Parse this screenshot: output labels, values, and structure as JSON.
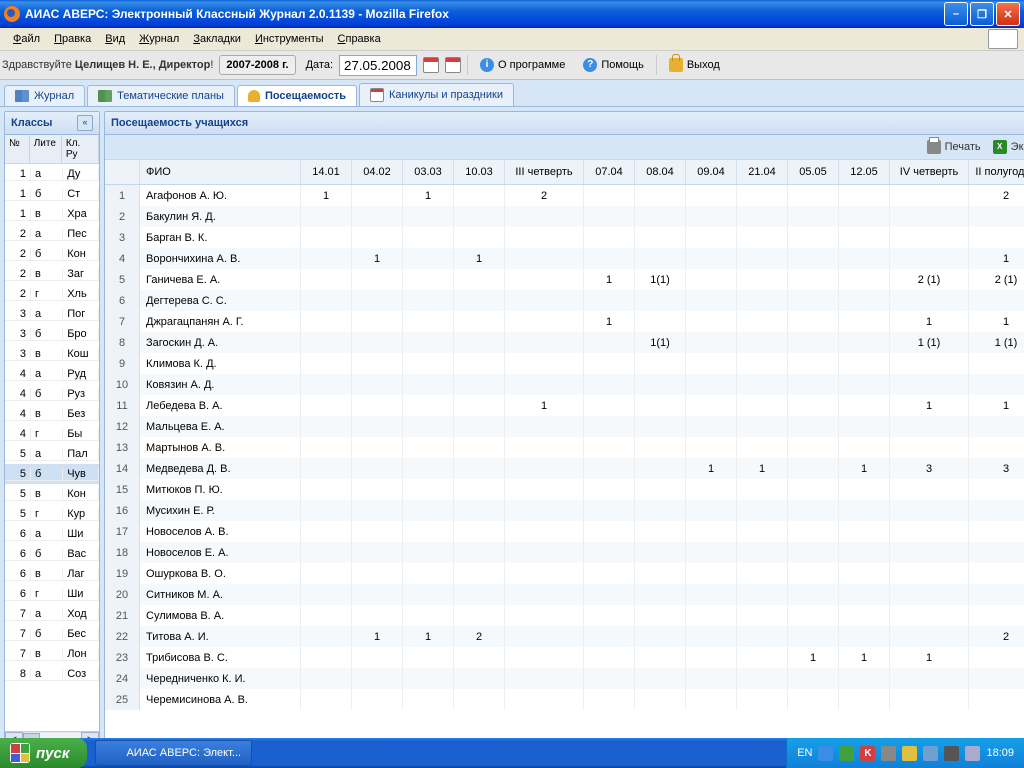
{
  "window": {
    "title": "АИАС АВЕРС: Электронный Классный Журнал 2.0.1139 - Mozilla Firefox"
  },
  "menu": {
    "file": "Файл",
    "edit": "Правка",
    "view": "Вид",
    "journal": "Журнал",
    "bookmarks": "Закладки",
    "tools": "Инструменты",
    "help": "Справка"
  },
  "greeting": {
    "prefix": "Здравствуйте ",
    "name": "Целищев Н. Е., Директор",
    "suffix": "!"
  },
  "year": "2007-2008 г.",
  "date_label": "Дата:",
  "date_value": "27.05.2008",
  "tb": {
    "about": "О программе",
    "help": "Помощь",
    "exit": "Выход"
  },
  "tabs": {
    "journal": "Журнал",
    "plans": "Тематические планы",
    "attendance": "Посещаемость",
    "holidays": "Каникулы и праздники"
  },
  "left": {
    "title": "Классы",
    "col_no": "№",
    "col_lit": "Лите",
    "col_ruk": "Кл. Ру",
    "rows": [
      {
        "n": "1",
        "l": "а",
        "r": "Ду"
      },
      {
        "n": "1",
        "l": "б",
        "r": "Ст"
      },
      {
        "n": "1",
        "l": "в",
        "r": "Хра"
      },
      {
        "n": "2",
        "l": "а",
        "r": "Пес"
      },
      {
        "n": "2",
        "l": "б",
        "r": "Кон"
      },
      {
        "n": "2",
        "l": "в",
        "r": "Заг"
      },
      {
        "n": "2",
        "l": "г",
        "r": "Хль"
      },
      {
        "n": "3",
        "l": "а",
        "r": "Пог"
      },
      {
        "n": "3",
        "l": "б",
        "r": "Бро"
      },
      {
        "n": "3",
        "l": "в",
        "r": "Кош"
      },
      {
        "n": "4",
        "l": "а",
        "r": "Руд"
      },
      {
        "n": "4",
        "l": "б",
        "r": "Руз"
      },
      {
        "n": "4",
        "l": "в",
        "r": "Без"
      },
      {
        "n": "4",
        "l": "г",
        "r": "Бы"
      },
      {
        "n": "5",
        "l": "а",
        "r": "Пал"
      },
      {
        "n": "5",
        "l": "б",
        "r": "Чув"
      },
      {
        "n": "5",
        "l": "в",
        "r": "Кон"
      },
      {
        "n": "5",
        "l": "г",
        "r": "Кур"
      },
      {
        "n": "6",
        "l": "а",
        "r": "Ши"
      },
      {
        "n": "6",
        "l": "б",
        "r": "Вас"
      },
      {
        "n": "6",
        "l": "в",
        "r": "Лаг"
      },
      {
        "n": "6",
        "l": "г",
        "r": "Ши"
      },
      {
        "n": "7",
        "l": "а",
        "r": "Ход"
      },
      {
        "n": "7",
        "l": "б",
        "r": "Бес"
      },
      {
        "n": "7",
        "l": "в",
        "r": "Лон"
      },
      {
        "n": "8",
        "l": "а",
        "r": "Соз"
      }
    ],
    "selected": 15
  },
  "right": {
    "title": "Посещаемость учащихся",
    "print": "Печать",
    "export": "Экспорт",
    "cols": {
      "fio": "ФИО",
      "d1": "14.01",
      "d2": "04.02",
      "d3": "03.03",
      "d4": "10.03",
      "q3": "III четверть",
      "d5": "07.04",
      "d6": "08.04",
      "d7": "09.04",
      "d8": "21.04",
      "d9": "05.05",
      "d10": "12.05",
      "q4": "IV четверть",
      "h2": "II полугодие"
    },
    "students": [
      {
        "n": 1,
        "name": "Агафонов А. Ю.",
        "c": {
          "d1": "1",
          "d3": "1",
          "q3": "2",
          "h2": "2"
        }
      },
      {
        "n": 2,
        "name": "Бакулин Я. Д.",
        "c": {}
      },
      {
        "n": 3,
        "name": "Барган В. К.",
        "c": {}
      },
      {
        "n": 4,
        "name": "Ворончихина А. В.",
        "c": {
          "d2": "1",
          "d4": "1",
          "h2": "1"
        }
      },
      {
        "n": 5,
        "name": "Ганичева Е. А.",
        "c": {
          "d5": "1",
          "d6": "1(1)",
          "q4": "2 (1)",
          "h2": "2 (1)"
        }
      },
      {
        "n": 6,
        "name": "Дегтерева С. С.",
        "c": {}
      },
      {
        "n": 7,
        "name": "Джрагацпанян А. Г.",
        "c": {
          "d5": "1",
          "q4": "1",
          "h2": "1"
        }
      },
      {
        "n": 8,
        "name": "Загоскин Д. А.",
        "c": {
          "d6": "1(1)",
          "q4": "1 (1)",
          "h2": "1 (1)"
        }
      },
      {
        "n": 9,
        "name": "Климова К. Д.",
        "c": {}
      },
      {
        "n": 10,
        "name": "Ковязин А. Д.",
        "c": {}
      },
      {
        "n": 11,
        "name": "Лебедева В. А.",
        "c": {
          "q3": "1",
          "q4": "1",
          "h2": "1"
        }
      },
      {
        "n": 12,
        "name": "Мальцева Е. А.",
        "c": {}
      },
      {
        "n": 13,
        "name": "Мартынов А. В.",
        "c": {}
      },
      {
        "n": 14,
        "name": "Медведева Д. В.",
        "c": {
          "d7": "1",
          "d8": "1",
          "d10": "1",
          "q4": "3",
          "h2": "3"
        }
      },
      {
        "n": 15,
        "name": "Митюков П. Ю.",
        "c": {}
      },
      {
        "n": 16,
        "name": "Мусихин Е. Р.",
        "c": {}
      },
      {
        "n": 17,
        "name": "Новоселов А. В.",
        "c": {}
      },
      {
        "n": 18,
        "name": "Новоселов Е. А.",
        "c": {}
      },
      {
        "n": 19,
        "name": "Ошуркова В. О.",
        "c": {}
      },
      {
        "n": 20,
        "name": "Ситников М. А.",
        "c": {}
      },
      {
        "n": 21,
        "name": "Сулимова В. А.",
        "c": {}
      },
      {
        "n": 22,
        "name": "Титова А. И.",
        "c": {
          "d2": "1",
          "d3": "1",
          "d4": "2",
          "h2": "2"
        }
      },
      {
        "n": 23,
        "name": "Трибисова В. С.",
        "c": {
          "d9": "1",
          "d10": "1",
          "q4": "1"
        }
      },
      {
        "n": 24,
        "name": "Чередниченко К. И.",
        "c": {}
      },
      {
        "n": 25,
        "name": "Черемисинова А. В.",
        "c": {}
      }
    ]
  },
  "taskbar": {
    "start": "пуск",
    "task": "АИАС АВЕРС: Элект...",
    "lang": "EN",
    "time": "18:09"
  }
}
